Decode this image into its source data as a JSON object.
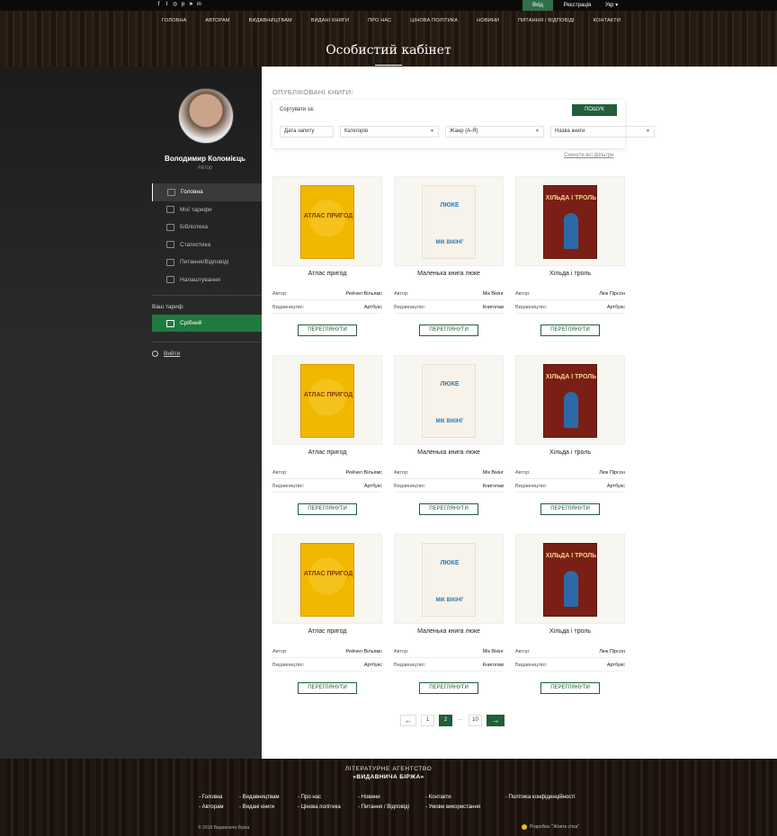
{
  "topbar": {
    "social_icons": [
      "facebook-icon",
      "twitter-icon",
      "instagram-icon",
      "pinterest-icon",
      "telegram-icon",
      "linkedin-icon"
    ],
    "social_glyphs": [
      "f",
      "t",
      "◎",
      "p",
      "➤",
      "in"
    ],
    "login": "Вхід",
    "register": "Реєстрація",
    "lang": "Укр"
  },
  "nav": [
    "ГОЛОВНА",
    "АВТОРАМ",
    "ВИДАВНИЦТВАМ",
    "ВИДАНІ КНИГИ",
    "ПРО НАС",
    "ЦІНОВА ПОЛІТИКА",
    "НОВИНИ",
    "ПИТАННЯ / ВІДПОВІДІ",
    "КОНТАКТИ"
  ],
  "page_title": "Особистий кабінет",
  "user": {
    "name": "Володимир Коломієць",
    "role": "Автор"
  },
  "menu": [
    {
      "label": "Головна",
      "icon": "home-icon",
      "active": true
    },
    {
      "label": "Мої тарифи",
      "icon": "tariffs-icon",
      "active": false
    },
    {
      "label": "Бібліотека",
      "icon": "library-icon",
      "active": false
    },
    {
      "label": "Статистика",
      "icon": "stats-icon",
      "active": false
    },
    {
      "label": "Питання/Відповіді",
      "icon": "faq-icon",
      "active": false
    },
    {
      "label": "Налаштування",
      "icon": "settings-icon",
      "active": false
    }
  ],
  "tariff": {
    "label": "Ваш тариф:",
    "value": "Срібний"
  },
  "logout": "Вийти",
  "main": {
    "section_title": "ОПУБЛІКОВАНІ КНИГИ:",
    "sort_label": "Сортувати за:",
    "search_button": "ПОШУК",
    "filters": [
      "Дата запиту",
      "Категорія",
      "Жанр (А-Я)",
      "Назва книги"
    ],
    "reset_filters": "Скинути всі фільтри",
    "author_label": "Автор:",
    "publisher_label": "Видавництво:",
    "view_button": "ПЕРЕГЛЯНУТИ",
    "books": [
      {
        "title": "Атлас пригод",
        "author": "Рейчел Вільямс",
        "publisher": "Артбукс",
        "cover": "АТЛАС ПРИГОД",
        "cover2": ""
      },
      {
        "title": "Маленька книга люке",
        "author": "Мік Вікінг",
        "publisher": "Книголав",
        "cover": "ЛЮКЕ",
        "cover2": "МІК ВІКІНГ"
      },
      {
        "title": "Хільда і троль",
        "author": "Люк Пірсон",
        "publisher": "Артбукс",
        "cover": "ХІЛЬДА І ТРОЛЬ",
        "cover2": ""
      },
      {
        "title": "Атлас пригод",
        "author": "Рейчел Вільямс",
        "publisher": "Артбукс",
        "cover": "АТЛАС ПРИГОД",
        "cover2": ""
      },
      {
        "title": "Маленька книга люке",
        "author": "Мік Вікінг",
        "publisher": "Книголав",
        "cover": "ЛЮКЕ",
        "cover2": "МІК ВІКІНГ"
      },
      {
        "title": "Хільда і троль",
        "author": "Люк Пірсон",
        "publisher": "Артбукс",
        "cover": "ХІЛЬДА І ТРОЛЬ",
        "cover2": ""
      },
      {
        "title": "Атлас пригод",
        "author": "Рейчел Вільямс",
        "publisher": "Артбукс",
        "cover": "АТЛАС ПРИГОД",
        "cover2": ""
      },
      {
        "title": "Маленька книга люке",
        "author": "Мік Вікінг",
        "publisher": "Книголав",
        "cover": "ЛЮКЕ",
        "cover2": "МІК ВІКІНГ"
      },
      {
        "title": "Хільда і троль",
        "author": "Люк Пірсон",
        "publisher": "Артбукс",
        "cover": "ХІЛЬДА І ТРОЛЬ",
        "cover2": ""
      }
    ],
    "pagination": {
      "prev": "←",
      "pages": [
        "1",
        "2",
        "...",
        "10"
      ],
      "current": "2",
      "next": "→"
    }
  },
  "footer": {
    "brand_line1": "ЛІТЕРАТУРНЕ АГЕНТСТВО",
    "brand_line2": "«ВИДАВНИЧА БІРЖА»",
    "links_row1": [
      "- Головна",
      "- Видавництвам",
      "- Про нас",
      "- Новини",
      "- Контакти",
      "- Політика конфіденційності"
    ],
    "links_row2": [
      "- Авторам",
      "- Видані книги",
      "- Цінова політика",
      "- Питання / Відповіді",
      "- Умови використання"
    ],
    "copyright": "© 2018 Видавнича біржа",
    "developer": "Розробка: \"Жовта сітка\""
  },
  "colors": {
    "accent_green": "#215e3a",
    "tariff_green": "#1f7a3f",
    "sidebar_bg": "#2a2a2a"
  }
}
